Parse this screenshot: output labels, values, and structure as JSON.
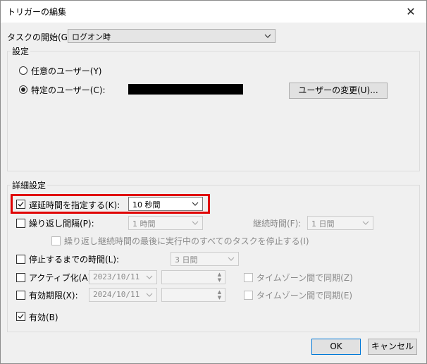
{
  "window": {
    "title": "トリガーの編集",
    "close_glyph": "✕"
  },
  "start_task": {
    "label": "タスクの開始(G):",
    "value": "ログオン時"
  },
  "settings": {
    "legend": "設定",
    "radio_any": "任意のユーザー(Y)",
    "radio_specific": "特定のユーザー(C):",
    "change_user_button": "ユーザーの変更(U)..."
  },
  "advanced": {
    "legend": "詳細設定",
    "delay": {
      "label": "遅延時間を指定する(K):",
      "value": "10 秒間",
      "checked": true
    },
    "repeat": {
      "label": "繰り返し間隔(P):",
      "value": "1 時間",
      "checked": false
    },
    "duration": {
      "label": "継続時間(F):",
      "value": "1 日間"
    },
    "stop_all": {
      "label": "繰り返し継続時間の最後に実行中のすべてのタスクを停止する(I)"
    },
    "stop_after": {
      "label": "停止するまでの時間(L):",
      "value": "3 日間",
      "checked": false
    },
    "activate": {
      "label": "アクティブ化(A):",
      "date": "2023/10/11",
      "sync_label": "タイムゾーン間で同期(Z)"
    },
    "expire": {
      "label": "有効期限(X):",
      "date": "2024/10/11",
      "sync_label": "タイムゾーン間で同期(E)"
    },
    "enabled": {
      "label": "有効(B)",
      "checked": true
    }
  },
  "buttons": {
    "ok": "OK",
    "cancel": "キャンセル"
  }
}
